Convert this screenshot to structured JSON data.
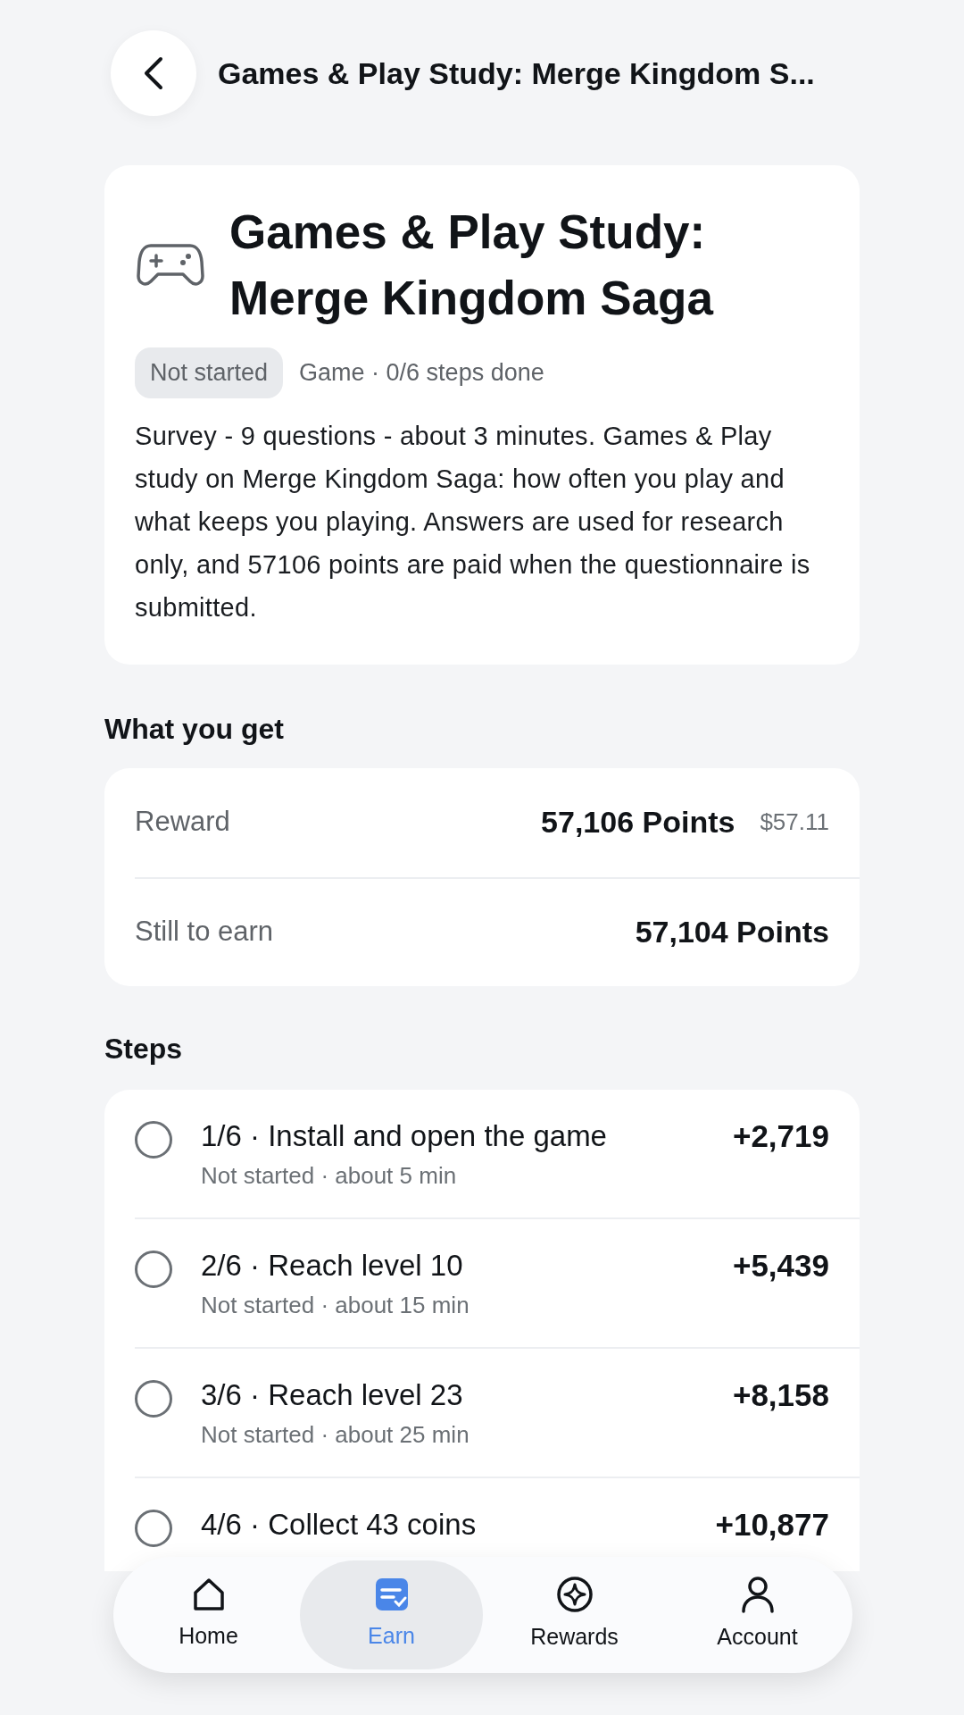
{
  "header": {
    "title": "Games & Play Study: Merge Kingdom S..."
  },
  "study": {
    "title": "Games & Play Study: Merge Kingdom Saga",
    "status": "Not started",
    "meta": "Game · 0/6 steps done",
    "description": "Survey - 9 questions - about 3 minutes. Games & Play study on Merge Kingdom Saga: how often you play and what keeps you playing. Answers are used for research only, and 57106 points are paid when the questionnaire is submitted."
  },
  "what_you_get": {
    "heading": "What you get",
    "rows": [
      {
        "label": "Reward",
        "value": "57,106 Points",
        "note": "$57.11"
      },
      {
        "label": "Still to earn",
        "value": "57,104 Points"
      }
    ]
  },
  "steps": {
    "heading": "Steps",
    "items": [
      {
        "title": "1/6 · Install and open the game",
        "meta": "Not started · about 5 min",
        "points": "+2,719",
        "checked": false
      },
      {
        "title": "2/6 · Reach level 10",
        "meta": "Not started · about 15 min",
        "points": "+5,439",
        "checked": false
      },
      {
        "title": "3/6 · Reach level 23",
        "meta": "Not started · about 25 min",
        "points": "+8,158",
        "checked": false
      },
      {
        "title": "4/6 · Collect 43 coins",
        "points": "+10,877",
        "checked": false
      }
    ]
  },
  "nav": [
    {
      "label": "Home",
      "kind": "home",
      "selected": false
    },
    {
      "label": "Earn",
      "kind": "earn",
      "selected": true
    },
    {
      "label": "Rewards",
      "kind": "rewards",
      "selected": false
    },
    {
      "label": "Account",
      "kind": "account",
      "selected": false
    }
  ]
}
